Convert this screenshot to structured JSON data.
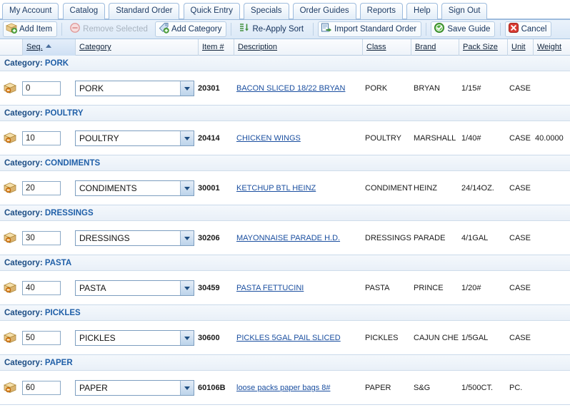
{
  "tabs": [
    {
      "label": "My Account",
      "name": "tab-my-account"
    },
    {
      "label": "Catalog",
      "name": "tab-catalog"
    },
    {
      "label": "Standard Order",
      "name": "tab-standard-order"
    },
    {
      "label": "Quick Entry",
      "name": "tab-quick-entry"
    },
    {
      "label": "Specials",
      "name": "tab-specials"
    },
    {
      "label": "Order Guides",
      "name": "tab-order-guides"
    },
    {
      "label": "Reports",
      "name": "tab-reports"
    },
    {
      "label": "Help",
      "name": "tab-help"
    },
    {
      "label": "Sign Out",
      "name": "tab-sign-out"
    }
  ],
  "toolbar": {
    "add_item": "Add Item",
    "remove_selected": "Remove Selected",
    "add_category": "Add Category",
    "reapply_sort": "Re-Apply Sort",
    "import_standard_order": "Import Standard Order",
    "save_guide": "Save Guide",
    "cancel": "Cancel"
  },
  "columns": {
    "seq": "Seq.",
    "category": "Category",
    "item_no": "Item #",
    "description": "Description",
    "class": "Class",
    "brand": "Brand",
    "pack_size": "Pack Size",
    "unit": "Unit",
    "weight": "Weight"
  },
  "sort": {
    "column": "Seq.",
    "direction": "asc"
  },
  "category_band_prefix": "Category:",
  "groups": [
    {
      "category_label": "PORK",
      "row": {
        "seq": "0",
        "category": "PORK",
        "item_no": "20301",
        "description": "BACON SLICED 18/22 BRYAN",
        "class": "PORK",
        "brand": "BRYAN",
        "pack_size": "1/15#",
        "unit": "CASE",
        "weight": ""
      }
    },
    {
      "category_label": "POULTRY",
      "row": {
        "seq": "10",
        "category": "POULTRY",
        "item_no": "20414",
        "description": "CHICKEN WINGS",
        "class": "POULTRY",
        "brand": "MARSHALL",
        "pack_size": "1/40#",
        "unit": "CASE",
        "weight": "40.0000"
      }
    },
    {
      "category_label": "CONDIMENTS",
      "row": {
        "seq": "20",
        "category": "CONDIMENTS",
        "item_no": "30001",
        "description": "KETCHUP BTL HEINZ",
        "class": "CONDIMENT",
        "brand": "HEINZ",
        "pack_size": "24/14OZ.",
        "unit": "CASE",
        "weight": ""
      }
    },
    {
      "category_label": "DRESSINGS",
      "row": {
        "seq": "30",
        "category": "DRESSINGS",
        "item_no": "30206",
        "description": "MAYONNAISE PARADE H.D.",
        "class": "DRESSINGS",
        "brand": "PARADE",
        "pack_size": "4/1GAL",
        "unit": "CASE",
        "weight": ""
      }
    },
    {
      "category_label": "PASTA",
      "row": {
        "seq": "40",
        "category": "PASTA",
        "item_no": "30459",
        "description": "PASTA FETTUCINI",
        "class": "PASTA",
        "brand": "PRINCE",
        "pack_size": "1/20#",
        "unit": "CASE",
        "weight": ""
      }
    },
    {
      "category_label": "PICKLES",
      "row": {
        "seq": "50",
        "category": "PICKLES",
        "item_no": "30600",
        "description": "PICKLES 5GAL PAIL SLICED",
        "class": "PICKLES",
        "brand": "CAJUN CHE",
        "pack_size": "1/5GAL",
        "unit": "CASE",
        "weight": ""
      }
    },
    {
      "category_label": "PAPER",
      "row": {
        "seq": "60",
        "category": "PAPER",
        "item_no": "60106B",
        "description": "loose packs paper bags 8#",
        "class": "PAPER",
        "brand": "S&G",
        "pack_size": "1/500CT.",
        "unit": "PC.",
        "weight": ""
      }
    }
  ],
  "colors": {
    "tab_border": "#9dbbdd",
    "link": "#1b4fa0",
    "category_text": "#1f5fa8",
    "toolbar_bg": "#dce9f7"
  }
}
